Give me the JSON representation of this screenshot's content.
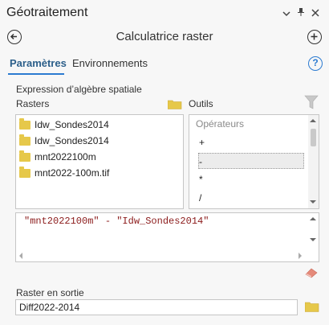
{
  "pane": {
    "title": "Géotraitement",
    "controls": {
      "menu_icon": "chevron-down-icon",
      "pin_icon": "pin-icon",
      "close_icon": "close-icon"
    }
  },
  "tool": {
    "title": "Calculatrice raster"
  },
  "tabs": [
    {
      "label": "Paramètres",
      "active": true
    },
    {
      "label": "Environnements",
      "active": false
    }
  ],
  "expression_section": {
    "heading": "Expression d’algèbre spatiale",
    "rasters_label": "Rasters",
    "tools_label": "Outils",
    "rasters": [
      "Idw_Sondes2014",
      "Idw_Sondes2014",
      "mnt2022100m",
      "mnt2022-100m.tif"
    ],
    "tools_placeholder": "Opérateurs",
    "operators": [
      "+",
      "-",
      "*",
      "/"
    ],
    "selected_operator": "-",
    "expression": "\"mnt2022100m\" - \"Idw_Sondes2014\""
  },
  "output": {
    "label": "Raster en sortie",
    "value": "Diff2022-2014"
  },
  "colors": {
    "accent": "#2c7bd1",
    "folder": "#e6c84a",
    "expression_text": "#8b1a1a"
  }
}
